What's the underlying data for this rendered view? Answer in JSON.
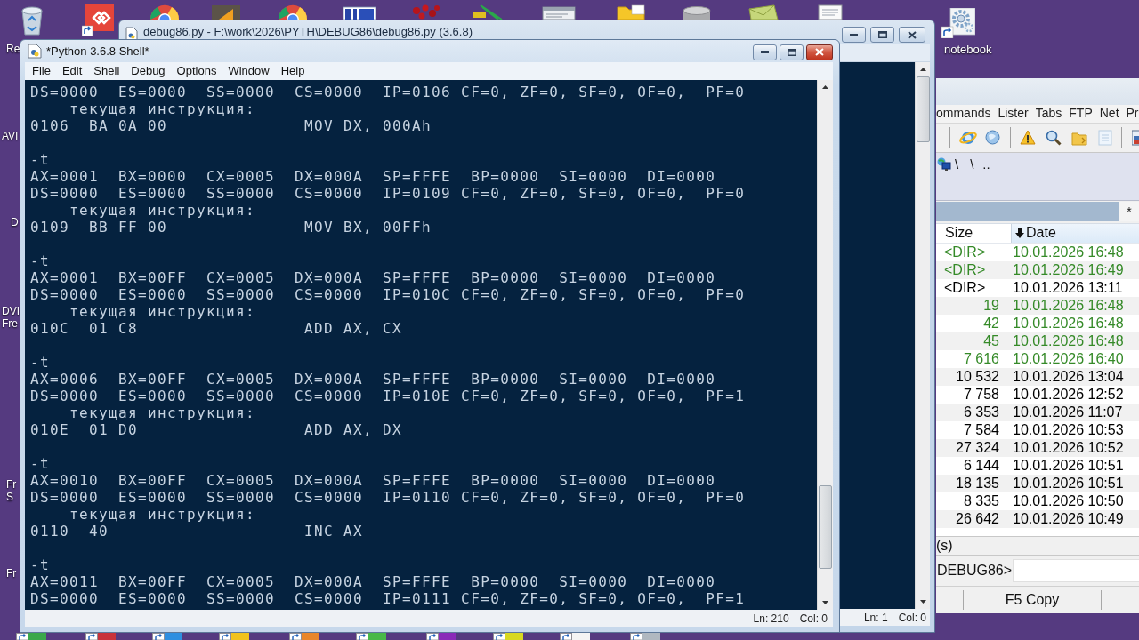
{
  "desktop": {
    "left_labels": [
      [
        "Re"
      ],
      [
        "AVI"
      ],
      [
        "D"
      ],
      [
        "DVI",
        "Fre"
      ],
      [
        "Fr",
        "S"
      ],
      [
        "Fr"
      ]
    ],
    "notebook": {
      "label": "notebook"
    }
  },
  "editor_window": {
    "title": "debug86.py - F:\\work\\2026\\PYTH\\DEBUG86\\debug86.py (3.6.8)",
    "active": false,
    "status": {
      "line": "Ln: 1",
      "col": "Col: 0"
    }
  },
  "shell_window": {
    "title": "*Python 3.6.8 Shell*",
    "active": true,
    "menu": [
      "File",
      "Edit",
      "Shell",
      "Debug",
      "Options",
      "Window",
      "Help"
    ],
    "output_blocks": [
      [
        "DS=0000  ES=0000  SS=0000  CS=0000  IP=0106 CF=0, ZF=0, SF=0, OF=0,  PF=0",
        "    текущая инструкция:",
        "0106  BA 0A 00              MOV DX, 000Ah"
      ],
      [
        "-t",
        "AX=0001  BX=0000  CX=0005  DX=000A  SP=FFFE  BP=0000  SI=0000  DI=0000",
        "DS=0000  ES=0000  SS=0000  CS=0000  IP=0109 CF=0, ZF=0, SF=0, OF=0,  PF=0",
        "    текущая инструкция:",
        "0109  BB FF 00              MOV BX, 00FFh"
      ],
      [
        "-t",
        "AX=0001  BX=00FF  CX=0005  DX=000A  SP=FFFE  BP=0000  SI=0000  DI=0000",
        "DS=0000  ES=0000  SS=0000  CS=0000  IP=010C CF=0, ZF=0, SF=0, OF=0,  PF=0",
        "    текущая инструкция:",
        "010C  01 C8                 ADD AX, CX"
      ],
      [
        "-t",
        "AX=0006  BX=00FF  CX=0005  DX=000A  SP=FFFE  BP=0000  SI=0000  DI=0000",
        "DS=0000  ES=0000  SS=0000  CS=0000  IP=010E CF=0, ZF=0, SF=0, OF=0,  PF=1",
        "    текущая инструкция:",
        "010E  01 D0                 ADD AX, DX"
      ],
      [
        "-t",
        "AX=0010  BX=00FF  CX=0005  DX=000A  SP=FFFE  BP=0000  SI=0000  DI=0000",
        "DS=0000  ES=0000  SS=0000  CS=0000  IP=0110 CF=0, ZF=0, SF=0, OF=0,  PF=0",
        "    текущая инструкция:",
        "0110  40                    INC AX"
      ],
      [
        "-t",
        "AX=0011  BX=00FF  CX=0005  DX=000A  SP=FFFE  BP=0000  SI=0000  DI=0000",
        "DS=0000  ES=0000  SS=0000  CS=0000  IP=0111 CF=0, ZF=0, SF=0, OF=0,  PF=1"
      ]
    ],
    "status": {
      "line": "Ln: 210",
      "col": "Col: 0"
    }
  },
  "file_manager": {
    "menu": [
      "ommands",
      "Lister",
      "Tabs",
      "FTP",
      "Net",
      "Pr"
    ],
    "path_buttons": [
      "\\",
      "\\",
      ".."
    ],
    "filter_mark": "*",
    "columns": [
      {
        "label": "Size",
        "sorted": false
      },
      {
        "label": "Date",
        "sorted": true
      }
    ],
    "rows": [
      {
        "kind": "dir",
        "size": "<DIR>",
        "date": "10.01.2026 16:48",
        "color": "#358a28"
      },
      {
        "kind": "dir",
        "size": "<DIR>",
        "date": "10.01.2026 16:49",
        "color": "#358a28"
      },
      {
        "kind": "dir",
        "size": "<DIR>",
        "date": "10.01.2026 13:11",
        "color": "#000000"
      },
      {
        "kind": "file",
        "size": "19",
        "date": "10.01.2026 16:48",
        "color": "#358a28"
      },
      {
        "kind": "file",
        "size": "42",
        "date": "10.01.2026 16:48",
        "color": "#358a28"
      },
      {
        "kind": "file",
        "size": "45",
        "date": "10.01.2026 16:48",
        "color": "#358a28"
      },
      {
        "kind": "file",
        "size": "7 616",
        "date": "10.01.2026 16:40",
        "color": "#358a28"
      },
      {
        "kind": "file",
        "size": "10 532",
        "date": "10.01.2026 13:04",
        "color": "#000000"
      },
      {
        "kind": "file",
        "size": "7 758",
        "date": "10.01.2026 12:52",
        "color": "#000000"
      },
      {
        "kind": "file",
        "size": "6 353",
        "date": "10.01.2026 11:07",
        "color": "#000000"
      },
      {
        "kind": "file",
        "size": "7 584",
        "date": "10.01.2026 10:53",
        "color": "#000000"
      },
      {
        "kind": "file",
        "size": "27 324",
        "date": "10.01.2026 10:52",
        "color": "#000000"
      },
      {
        "kind": "file",
        "size": "6 144",
        "date": "10.01.2026 10:51",
        "color": "#000000"
      },
      {
        "kind": "file",
        "size": "18 135",
        "date": "10.01.2026 10:51",
        "color": "#000000"
      },
      {
        "kind": "file",
        "size": "8 335",
        "date": "10.01.2026 10:50",
        "color": "#000000"
      },
      {
        "kind": "file",
        "size": "26 642",
        "date": "10.01.2026 10:49",
        "color": "#000000"
      }
    ],
    "info": "(s)",
    "command_prompt": "DEBUG86>",
    "function_keys": [
      "F5 Copy"
    ]
  }
}
